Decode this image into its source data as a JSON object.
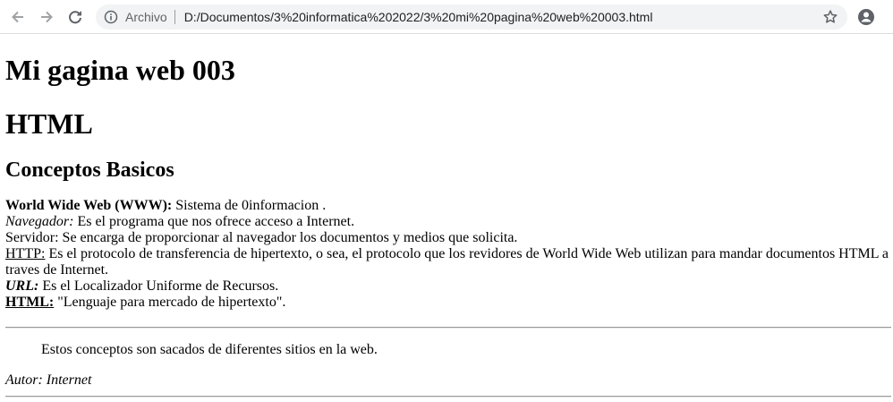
{
  "browser": {
    "scheme_label": "Archivo",
    "url": "D:/Documentos/3%20informatica%202022/3%20mi%20pagina%20web%20003.html"
  },
  "page": {
    "title1": "Mi gagina web 003",
    "title2": "HTML",
    "subtitle": "Conceptos Basicos",
    "concepts": [
      {
        "term": "World Wide Web (WWW):",
        "desc": " Sistema de 0informacion ."
      },
      {
        "term": "Navegador:",
        "desc": " Es el programa que nos ofrece acceso a Internet."
      },
      {
        "term": "Servidor:",
        "desc": " Se encarga de proporcionar al navegador los documentos y medios que solicita."
      },
      {
        "term": "HTTP:",
        "desc": " Es el protocolo de transferencia de hipertexto, o sea, el protocolo que los revidores de World Wide Web utilizan para mandar documentos HTML a traves de Internet."
      },
      {
        "term": "URL:",
        "desc": " Es el Localizador Uniforme de Recursos."
      },
      {
        "term": "HTML:",
        "desc": " \"Lenguaje para mercado de hipertexto\"."
      }
    ],
    "quote": "Estos conceptos son sacados de diferentes sitios en la web.",
    "author": "Autor: Internet"
  }
}
